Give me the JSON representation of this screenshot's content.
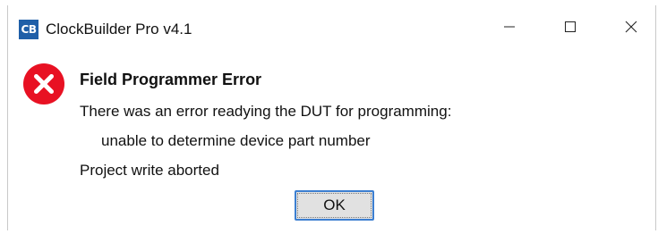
{
  "window": {
    "title": "ClockBuilder Pro v4.1",
    "app_icon_text": "CB",
    "controls": [
      "minimize-icon",
      "maximize-icon",
      "close-icon"
    ]
  },
  "dialog": {
    "icon": "error-icon",
    "heading": "Field Programmer Error",
    "lines": [
      "There was an error readying the DUT for programming:",
      "unable to determine device part number",
      "Project write aborted"
    ],
    "ok_label": "OK"
  },
  "colors": {
    "error_red": "#e81123",
    "app_icon_blue": "#1f5fa8",
    "button_focus_border": "#3c7fd1",
    "button_face": "#e1e1e1"
  }
}
